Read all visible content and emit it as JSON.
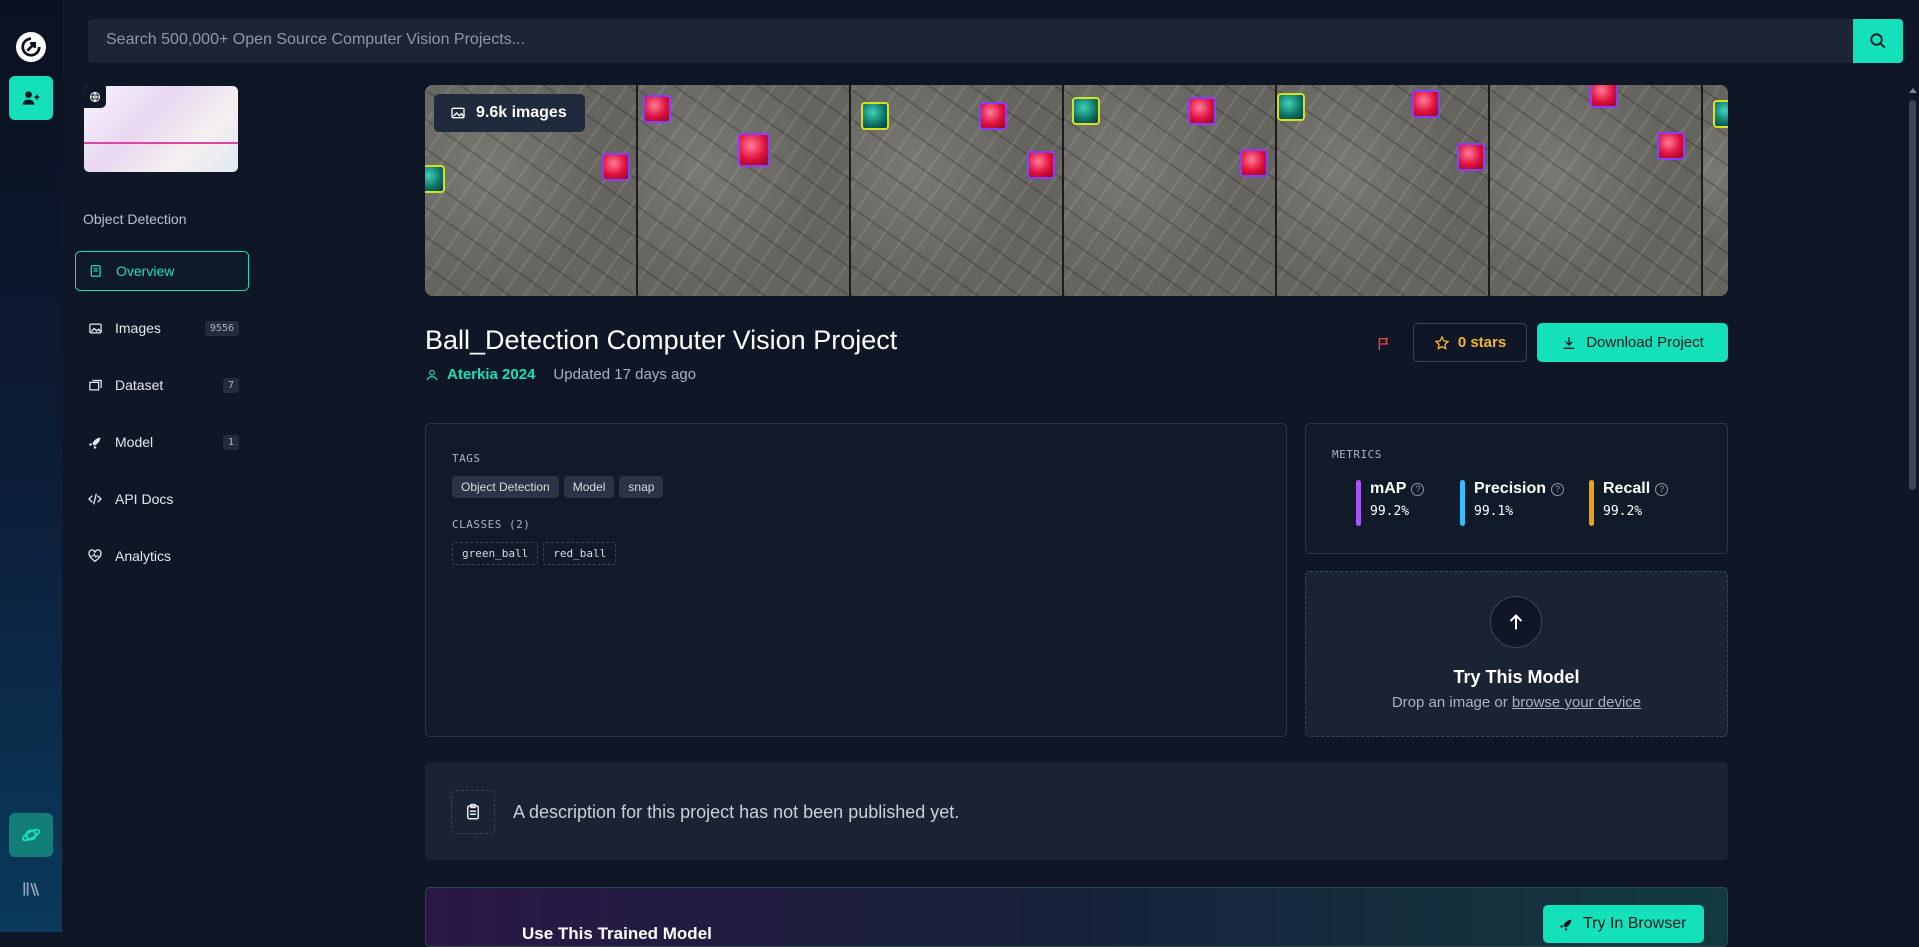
{
  "search": {
    "placeholder": "Search 500,000+ Open Source Computer Vision Projects..."
  },
  "sidebar": {
    "project_type": "Object Detection",
    "items": [
      {
        "label": "Overview",
        "icon": "book-icon",
        "count": ""
      },
      {
        "label": "Images",
        "icon": "images-icon",
        "count": "9556"
      },
      {
        "label": "Dataset",
        "icon": "layers-icon",
        "count": "7"
      },
      {
        "label": "Model",
        "icon": "rocket-icon",
        "count": "1"
      },
      {
        "label": "API Docs",
        "icon": "code-icon",
        "count": ""
      },
      {
        "label": "Analytics",
        "icon": "heartbeat-icon",
        "count": ""
      }
    ]
  },
  "banner": {
    "image_count": "9.6k images"
  },
  "project": {
    "title": "Ball_Detection Computer Vision Project",
    "author": "Aterkia 2024",
    "updated": "Updated 17 days ago",
    "stars": "0 stars",
    "download_label": "Download Project"
  },
  "tags_card": {
    "tags_label": "TAGS",
    "tags": [
      "Object Detection",
      "Model",
      "snap"
    ],
    "classes_label": "CLASSES (2)",
    "classes": [
      "green_ball",
      "red_ball"
    ]
  },
  "metrics": {
    "label": "METRICS",
    "items": [
      {
        "name": "mAP",
        "value": "99.2%",
        "color": "#a855f7"
      },
      {
        "name": "Precision",
        "value": "99.1%",
        "color": "#38bdf8"
      },
      {
        "name": "Recall",
        "value": "99.2%",
        "color": "#f59e0b"
      }
    ]
  },
  "try_model": {
    "title": "Try This Model",
    "sub_prefix": "Drop an image or",
    "sub_link": "browse your device"
  },
  "description": {
    "text": "A description for this project has not been published yet."
  },
  "promo": {
    "title": "Use This Trained Model",
    "button": "Try In Browser"
  },
  "colors": {
    "accent": "#14e0b9",
    "background": "#0f1726",
    "star": "#f4b42b",
    "flag": "#ef4444"
  }
}
